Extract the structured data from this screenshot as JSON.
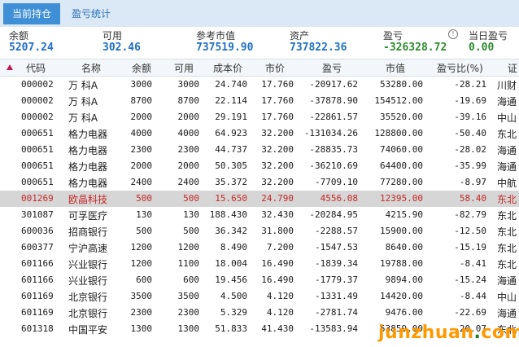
{
  "tabs": [
    {
      "label": "当前持仓"
    },
    {
      "label": "盈亏统计"
    }
  ],
  "summary": [
    {
      "label": "余额",
      "value": "5207.24",
      "color": "#1e6fc7"
    },
    {
      "label": "可用",
      "value": "302.46",
      "color": "#1e6fc7"
    },
    {
      "label": "参考市值",
      "value": "737519.90",
      "color": "#1e6fc7"
    },
    {
      "label": "资产",
      "value": "737822.36",
      "color": "#1e6fc7"
    },
    {
      "label": "盈亏",
      "value": "-326328.72",
      "color": "#2e8b2e"
    },
    {
      "label": "当日盈亏",
      "value": "0.00",
      "color": "#2e8b2e"
    }
  ],
  "columns": [
    "代码",
    "名称",
    "余额",
    "可用",
    "成本价",
    "市价",
    "盈亏",
    "市值",
    "盈亏比(%)",
    "证"
  ],
  "rows": [
    {
      "code": "000002",
      "name": "万 科A",
      "bal": "3000",
      "avail": "3000",
      "cost": "24.740",
      "price": "17.760",
      "pl": "-20917.62",
      "mv": "53280.00",
      "pct": "-28.21",
      "broker": "川财"
    },
    {
      "code": "000002",
      "name": "万  科A",
      "bal": "8700",
      "avail": "8700",
      "cost": "22.114",
      "price": "17.760",
      "pl": "-37878.90",
      "mv": "154512.00",
      "pct": "-19.69",
      "broker": "海通"
    },
    {
      "code": "000002",
      "name": "万 科A",
      "bal": "2000",
      "avail": "2000",
      "cost": "29.191",
      "price": "17.760",
      "pl": "-22861.57",
      "mv": "35520.00",
      "pct": "-39.16",
      "broker": "中山"
    },
    {
      "code": "000651",
      "name": "格力电器",
      "bal": "4000",
      "avail": "4000",
      "cost": "64.923",
      "price": "32.200",
      "pl": "-131034.26",
      "mv": "128800.00",
      "pct": "-50.40",
      "broker": "东北"
    },
    {
      "code": "000651",
      "name": "格力电器",
      "bal": "2300",
      "avail": "2300",
      "cost": "44.737",
      "price": "32.200",
      "pl": "-28835.73",
      "mv": "74060.00",
      "pct": "-28.02",
      "broker": "海通"
    },
    {
      "code": "000651",
      "name": "格力电器",
      "bal": "2000",
      "avail": "2000",
      "cost": "50.305",
      "price": "32.200",
      "pl": "-36210.69",
      "mv": "64400.00",
      "pct": "-35.99",
      "broker": "海通"
    },
    {
      "code": "000651",
      "name": "格力电器",
      "bal": "2400",
      "avail": "2400",
      "cost": "35.372",
      "price": "32.200",
      "pl": "-7709.10",
      "mv": "77280.00",
      "pct": "-8.97",
      "broker": "中航"
    },
    {
      "code": "001269",
      "name": "欧晶科技",
      "bal": "500",
      "avail": "500",
      "cost": "15.650",
      "price": "24.790",
      "pl": "4556.08",
      "mv": "12395.00",
      "pct": "58.40",
      "broker": "东北",
      "selected": true
    },
    {
      "code": "301087",
      "name": "可孚医疗",
      "bal": "130",
      "avail": "130",
      "cost": "188.430",
      "price": "32.430",
      "pl": "-20284.95",
      "mv": "4215.90",
      "pct": "-82.79",
      "broker": "东北"
    },
    {
      "code": "600036",
      "name": "招商银行",
      "bal": "500",
      "avail": "500",
      "cost": "36.342",
      "price": "31.800",
      "pl": "-2288.57",
      "mv": "15900.00",
      "pct": "-12.50",
      "broker": "东北"
    },
    {
      "code": "600377",
      "name": "宁沪高速",
      "bal": "1200",
      "avail": "1200",
      "cost": "8.490",
      "price": "7.200",
      "pl": "-1547.53",
      "mv": "8640.00",
      "pct": "-15.19",
      "broker": "东北"
    },
    {
      "code": "601166",
      "name": "兴业银行",
      "bal": "1200",
      "avail": "1100",
      "cost": "18.004",
      "price": "16.490",
      "pl": "-1839.34",
      "mv": "19788.00",
      "pct": "-8.41",
      "broker": "东北"
    },
    {
      "code": "601166",
      "name": "兴业银行",
      "bal": "600",
      "avail": "600",
      "cost": "19.456",
      "price": "16.490",
      "pl": "-1779.37",
      "mv": "9894.00",
      "pct": "-15.24",
      "broker": "海通"
    },
    {
      "code": "601169",
      "name": "北京银行",
      "bal": "3500",
      "avail": "3500",
      "cost": "4.500",
      "price": "4.120",
      "pl": "-1331.49",
      "mv": "14420.00",
      "pct": "-8.44",
      "broker": "中山"
    },
    {
      "code": "601169",
      "name": "北京银行",
      "bal": "2300",
      "avail": "2300",
      "cost": "5.329",
      "price": "4.120",
      "pl": "-2781.74",
      "mv": "9476.00",
      "pct": "-22.69",
      "broker": "海通"
    },
    {
      "code": "601318",
      "name": "中国平安",
      "bal": "1300",
      "avail": "1300",
      "cost": "51.833",
      "price": "41.430",
      "pl": "-13583.94",
      "mv": "53859.00",
      "pct": "-20.07",
      "broker": "东北"
    }
  ],
  "watermark": {
    "left": "junzhuan",
    "dot": ".",
    "right": "com"
  }
}
